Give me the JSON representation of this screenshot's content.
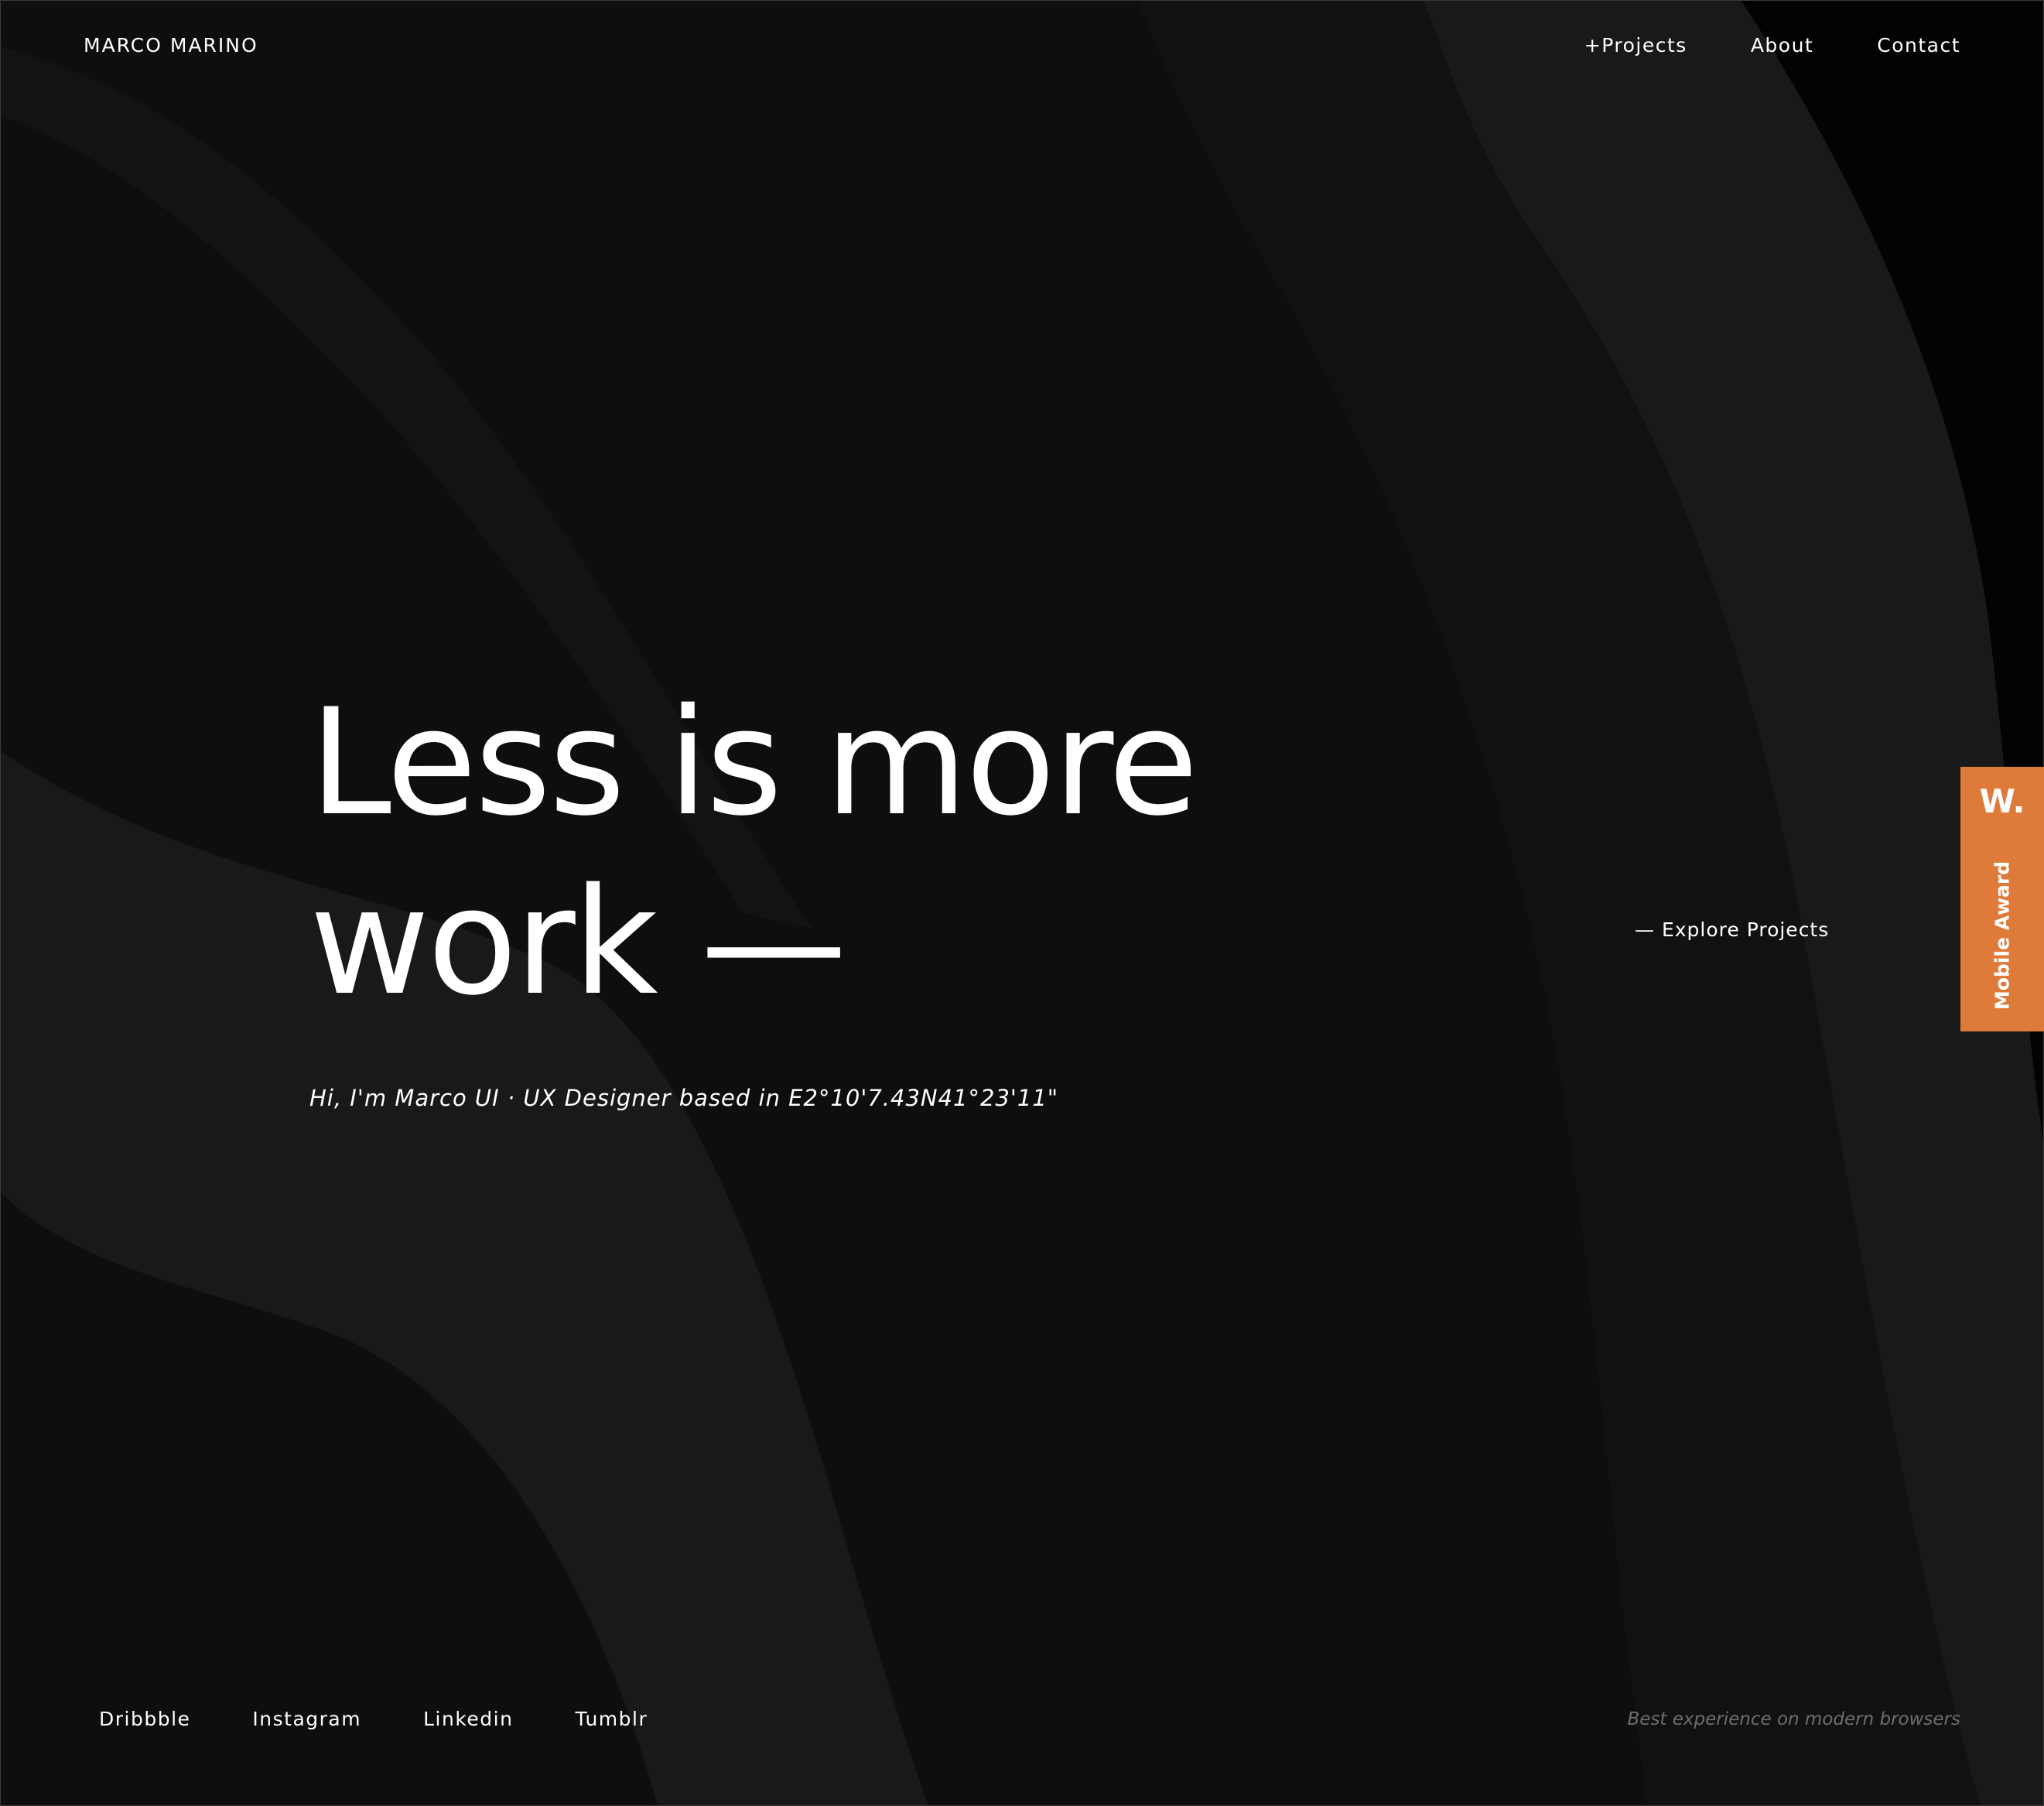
{
  "header": {
    "brand": "MARCO MARINO",
    "nav": [
      {
        "label": "+Projects"
      },
      {
        "label": "About"
      },
      {
        "label": "Contact"
      }
    ]
  },
  "hero": {
    "title_line1": "Less is more",
    "title_line2": "work —",
    "subtitle": "Hi, I'm Marco UI · UX Designer based in E2°10'7.43N41°23'11\""
  },
  "explore_link": "— Explore Projects",
  "award": {
    "logo": "W.",
    "label": "Mobile Award"
  },
  "footer": {
    "social": [
      {
        "label": "Dribbble"
      },
      {
        "label": "Instagram"
      },
      {
        "label": "Linkedin"
      },
      {
        "label": "Tumblr"
      }
    ],
    "note": "Best experience on modern browsers"
  },
  "colors": {
    "background": "#0e0e0f",
    "wave_light": "#18191b",
    "wave_dark": "#111112",
    "text": "#ffffff",
    "muted_text": "#6d6d70",
    "award_orange": "#df7b3a"
  }
}
